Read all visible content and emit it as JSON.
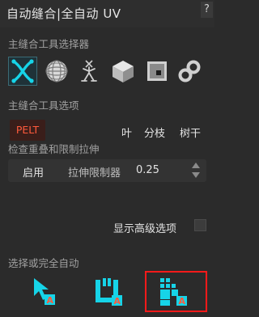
{
  "header": {
    "title": "自动缝合|全自动 UV",
    "help_label": "?"
  },
  "main_stitch": {
    "section_label": "主缝合工具选择器",
    "tools": [
      {
        "icon": "pelt-x-icon",
        "selected": true
      },
      {
        "icon": "sphere-grid-icon",
        "selected": false
      },
      {
        "icon": "figure-icon",
        "selected": false
      },
      {
        "icon": "cube-icon",
        "selected": false
      },
      {
        "icon": "square-point-icon",
        "selected": false
      },
      {
        "icon": "chain-link-icon",
        "selected": false
      }
    ]
  },
  "stitch_options": {
    "section_label": "主缝合工具选项",
    "pelt_label": "PELT",
    "leaf_label": "叶",
    "branch_label": "分枝",
    "trunk_label": "树干"
  },
  "overlap": {
    "section_label": "检查重叠和限制拉伸",
    "enable_label": "启用",
    "stretch_label": "拉伸限制器",
    "stretch_value": "0.25"
  },
  "advanced": {
    "label": "显示高级选项",
    "checked": false
  },
  "auto": {
    "section_label": "选择或完全自动",
    "buttons": [
      {
        "icon": "select-cursor-auto-icon"
      },
      {
        "icon": "unwrap-auto-icon"
      },
      {
        "icon": "pack-grid-auto-icon"
      }
    ]
  },
  "colors": {
    "accent_cyan": "#16d4e8",
    "accent_red": "#ff5a3c",
    "highlight_red": "#ff1a1a"
  }
}
